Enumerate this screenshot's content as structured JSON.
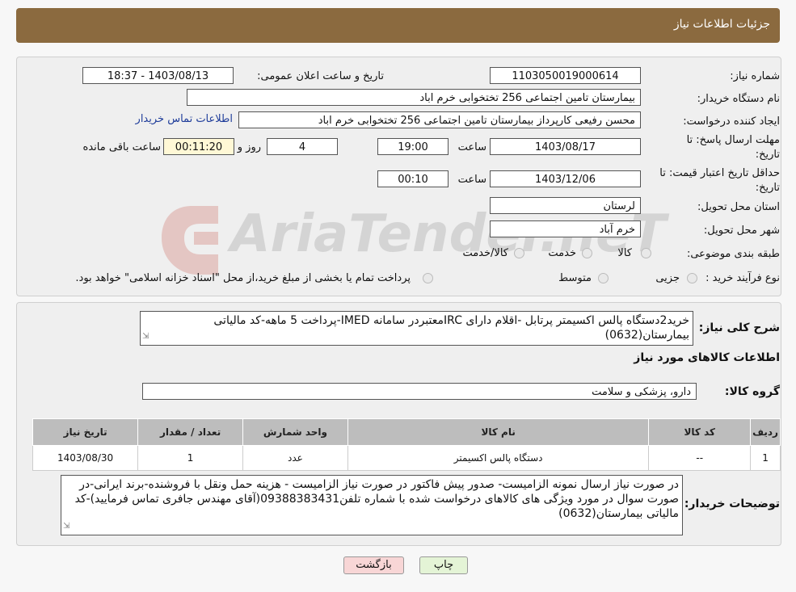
{
  "header": {
    "title": "جزئیات اطلاعات نیاز"
  },
  "form": {
    "need_number_label": "شماره نیاز:",
    "need_number": "1103050019000614",
    "announce_label": "تاریخ و ساعت اعلان عمومی:",
    "announce_value": "1403/08/13 - 18:37",
    "buyer_org_label": "نام دستگاه خریدار:",
    "buyer_org": "بیمارستان تامین اجتماعی  256 تختخوابی خرم اباد",
    "creator_label": "ایجاد کننده درخواست:",
    "creator": "محسن رفیعی کارپرداز بیمارستان تامین اجتماعی  256 تختخوابی خرم اباد",
    "contact_link": "اطلاعات تماس خریدار",
    "deadline_label": "مهلت ارسال پاسخ: تا تاریخ:",
    "deadline_date": "1403/08/17",
    "time_label": "ساعت",
    "deadline_time": "19:00",
    "days": "4",
    "days_label": "روز و",
    "remaining": "00:11:20",
    "remaining_label": "ساعت باقی مانده",
    "validity_label": "حداقل تاریخ اعتبار قیمت: تا تاریخ:",
    "validity_date": "1403/12/06",
    "validity_time": "00:10",
    "province_label": "استان محل تحویل:",
    "province": "لرستان",
    "city_label": "شهر محل تحویل:",
    "city": "خرم آباد",
    "category_label": "طبقه بندی موضوعی:",
    "category_options": [
      "کالا",
      "خدمت",
      "کالا/خدمت"
    ],
    "process_label": "نوع فرآیند خرید :",
    "process_options": [
      "جزیی",
      "متوسط"
    ],
    "process_note": "پرداخت تمام یا بخشی از مبلغ خرید،از محل \"اسناد خزانه اسلامی\" خواهد بود."
  },
  "details": {
    "summary_label": "شرح کلی نیاز:",
    "summary": "خرید2دستگاه پالس اکسیمتر پرتابل -اقلام دارای IRCمعتبردر سامانه IMED-پرداخت 5 ماهه-کد مالیاتی بیمارستان(0632)",
    "items_title": "اطلاعات کالاهای مورد نیاز",
    "group_label": "گروه کالا:",
    "group_value": "دارو، پزشکی و سلامت",
    "table_headers": [
      "ردیف",
      "کد کالا",
      "نام کالا",
      "واحد شمارش",
      "تعداد / مقدار",
      "تاریخ نیاز"
    ],
    "table_rows": [
      [
        "1",
        "--",
        "دستگاه پالس اکسیمتر",
        "عدد",
        "1",
        "1403/08/30"
      ]
    ],
    "buyer_notes_label": "توضیحات خریدار:",
    "buyer_notes": "در صورت نیاز ارسال نمونه الزامیست- صدور پیش فاکتور در صورت نیاز الزامیست - هزینه حمل ونقل با فروشنده-برند ایرانی-در صورت سوال در مورد ویژگی های کالاهای درخواست شده با شماره تلفن09388383431(آقای مهندس جافری تماس فرمایید)-کد مالیاتی بیمارستان(0632)"
  },
  "buttons": {
    "print": "چاپ",
    "back": "بازگشت"
  },
  "watermark": {
    "text": "AriaTender.neT"
  },
  "colors": {
    "header": "#8b6a3f",
    "link": "#1e3c9a",
    "back_button": "#f8d6d6",
    "print_button": "#e4f4d6"
  }
}
